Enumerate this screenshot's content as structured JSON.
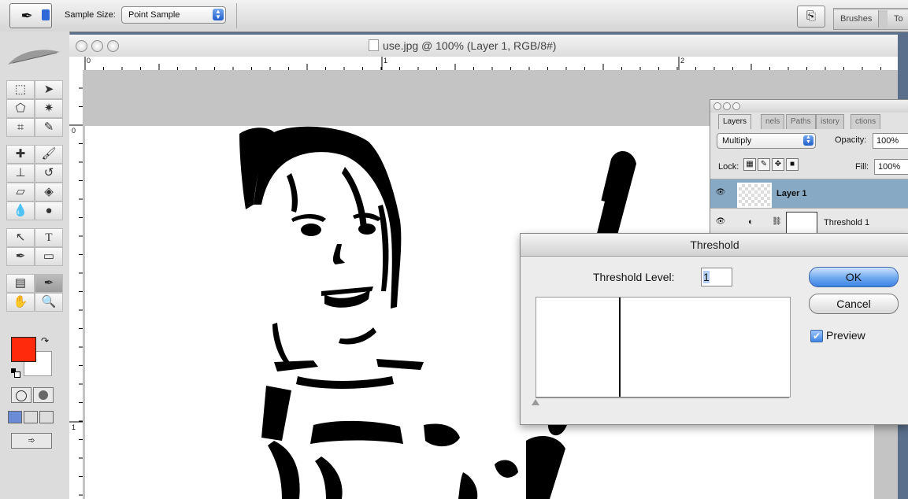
{
  "options_bar": {
    "sample_size_label": "Sample Size:",
    "sample_size_value": "Point Sample",
    "palette_tabs": [
      "Brushes",
      "To"
    ]
  },
  "document": {
    "title": "use.jpg @ 100% (Layer 1, RGB/8#)",
    "h_ruler_labels": [
      "0",
      "1",
      "2"
    ],
    "v_ruler_labels": [
      "0",
      "1"
    ]
  },
  "layers_palette": {
    "tabs": [
      "Layers",
      "nels",
      "Paths",
      "istory",
      "ctions"
    ],
    "blend_mode": "Multiply",
    "opacity_label": "Opacity:",
    "opacity_value": "100%",
    "lock_label": "Lock:",
    "fill_label": "Fill:",
    "fill_value": "100%",
    "layers": [
      {
        "name": "Layer 1",
        "selected": true
      },
      {
        "name": "Threshold 1",
        "selected": false
      }
    ]
  },
  "threshold_dialog": {
    "title": "Threshold",
    "level_label": "Threshold Level:",
    "level_value": "1",
    "ok_label": "OK",
    "cancel_label": "Cancel",
    "preview_label": "Preview",
    "preview_checked": true
  },
  "colors": {
    "foreground": "#ff2a0c",
    "background": "#ffffff",
    "accent": "#3d83e3",
    "selected_layer": "#88a9c3"
  },
  "icons": [
    "eyedropper-icon",
    "marquee-icon",
    "move-icon",
    "lasso-icon",
    "magic-wand-icon",
    "crop-icon",
    "slice-icon",
    "healing-icon",
    "brush-icon",
    "stamp-icon",
    "history-brush-icon",
    "eraser-icon",
    "paint-bucket-icon",
    "blur-icon",
    "dodge-icon",
    "path-select-icon",
    "type-icon",
    "pen-icon",
    "shape-icon",
    "notes-icon",
    "eyedropper-icon",
    "hand-icon",
    "zoom-icon",
    "eye-icon",
    "lock-icon"
  ]
}
